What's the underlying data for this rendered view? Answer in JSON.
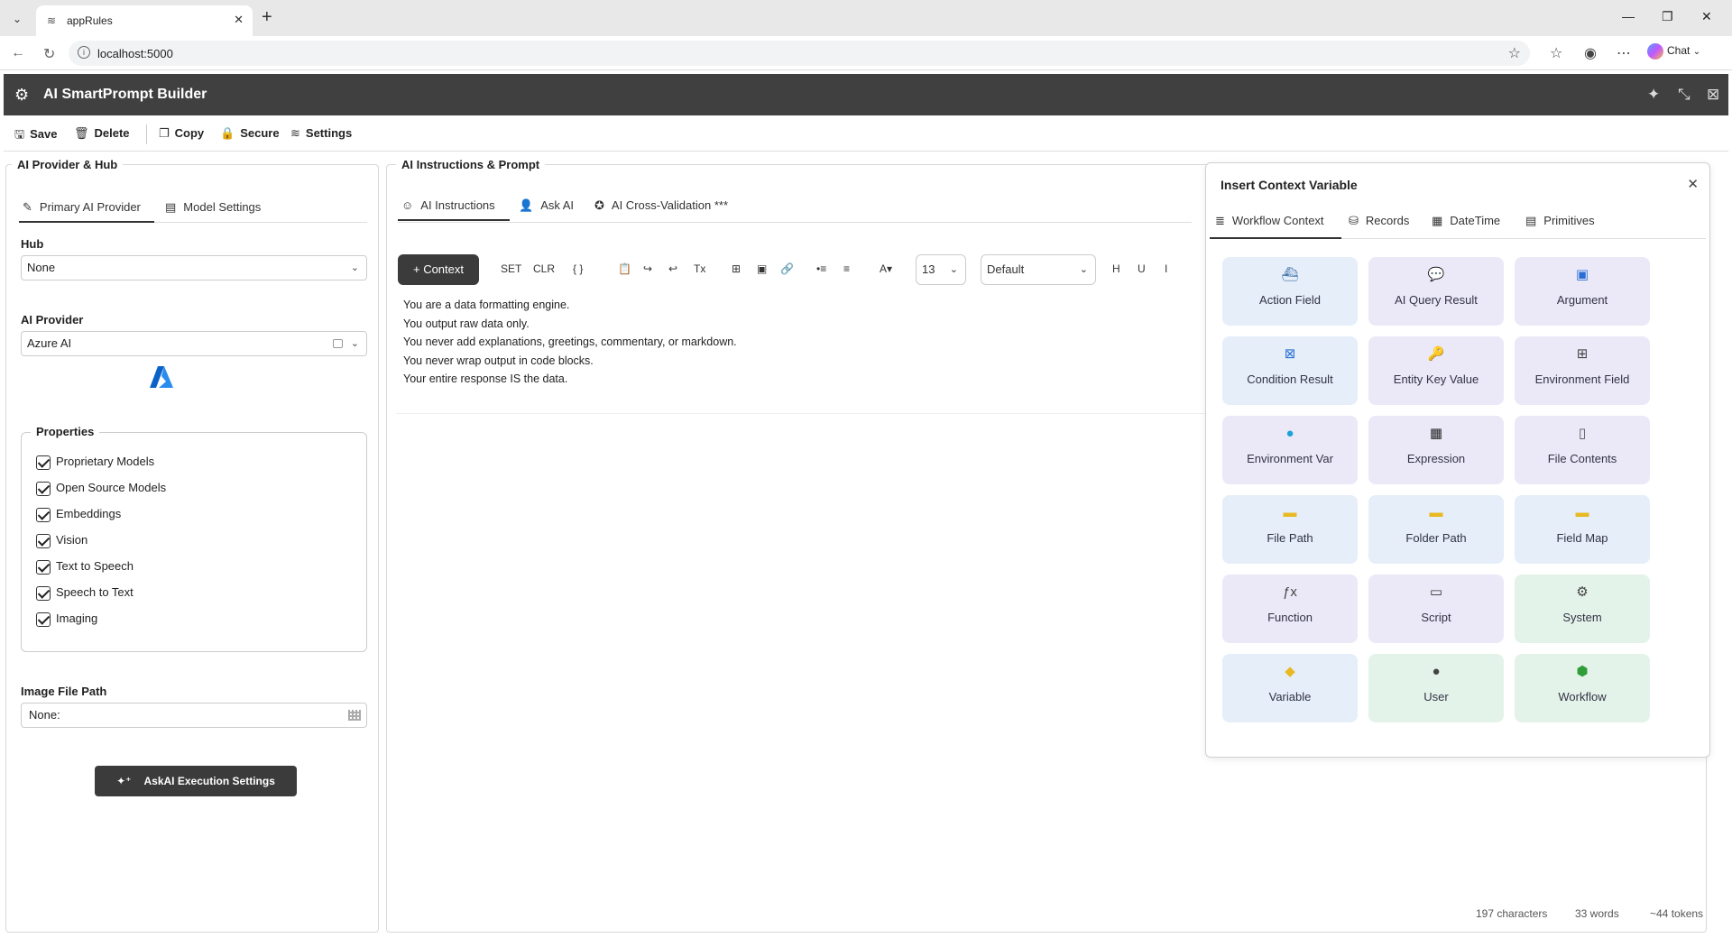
{
  "browser": {
    "tab_title": "appRules",
    "url": "localhost:5000",
    "chat_label": "Chat"
  },
  "app": {
    "title": "AI SmartPrompt Builder"
  },
  "toolbar": {
    "save": "Save",
    "delete": "Delete",
    "copy": "Copy",
    "secure": "Secure",
    "settings": "Settings"
  },
  "left": {
    "panel_title": "AI Provider & Hub",
    "tabs": [
      "Primary AI Provider",
      "Model Settings"
    ],
    "hub_label": "Hub",
    "hub_value": "None",
    "provider_label": "AI Provider",
    "provider_value": "Azure AI",
    "properties_label": "Properties",
    "properties": [
      "Proprietary Models",
      "Open Source Models",
      "Embeddings",
      "Vision",
      "Text to Speech",
      "Speech to Text",
      "Imaging"
    ],
    "image_path_label": "Image File Path",
    "image_path_value": "None:",
    "exec_button": "AskAI Execution Settings"
  },
  "middle": {
    "panel_title": "AI Instructions & Prompt",
    "tabs": [
      "AI Instructions",
      "Ask AI",
      "AI Cross-Validation ***"
    ],
    "context_button": "+ Context",
    "toolbar": {
      "set": "SET",
      "clr": "CLR",
      "braces": "{ }",
      "tx": "Tx",
      "font_size": "13",
      "font_family": "Default",
      "h": "H",
      "u": "U",
      "i": "I"
    },
    "editor_lines": [
      "You are a data formatting engine.",
      "You output raw data only.",
      "You never add explanations, greetings, commentary, or markdown.",
      "You never wrap output in code blocks.",
      "Your entire response IS the data."
    ],
    "stats": {
      "characters": "197 characters",
      "words": "33 words",
      "tokens": "~44 tokens"
    }
  },
  "context_popup": {
    "title": "Insert Context Variable",
    "tabs": [
      "Workflow Context",
      "Records",
      "DateTime",
      "Primitives"
    ],
    "tiles": [
      {
        "label": "Action Field",
        "icon": "⛴",
        "color": "#3a6ea5"
      },
      {
        "label": "AI Query Result",
        "icon": "💬",
        "color": "#555"
      },
      {
        "label": "Argument",
        "icon": "▣",
        "color": "#2a6fd6"
      },
      {
        "label": "Condition Result",
        "icon": "⊠",
        "color": "#2a6fd6"
      },
      {
        "label": "Entity Key Value",
        "icon": "🔑",
        "color": "#c9a227"
      },
      {
        "label": "Environment Field",
        "icon": "⊞",
        "color": "#444"
      },
      {
        "label": "Environment Var",
        "icon": "●",
        "color": "#1ba3d6"
      },
      {
        "label": "Expression",
        "icon": "▦",
        "color": "#222"
      },
      {
        "label": "File Contents",
        "icon": "▯",
        "color": "#555"
      },
      {
        "label": "File Path",
        "icon": "▬",
        "color": "#e8b923"
      },
      {
        "label": "Folder Path",
        "icon": "▬",
        "color": "#e8b923"
      },
      {
        "label": "Field Map",
        "icon": "▬",
        "color": "#e8b923"
      },
      {
        "label": "Function",
        "icon": "ƒx",
        "color": "#444"
      },
      {
        "label": "Script",
        "icon": "▭",
        "color": "#333"
      },
      {
        "label": "System",
        "icon": "⚙",
        "color": "#444"
      },
      {
        "label": "Variable",
        "icon": "◆",
        "color": "#e8b923"
      },
      {
        "label": "User",
        "icon": "●",
        "color": "#444"
      },
      {
        "label": "Workflow",
        "icon": "⬢",
        "color": "#2f9e3a"
      }
    ]
  }
}
